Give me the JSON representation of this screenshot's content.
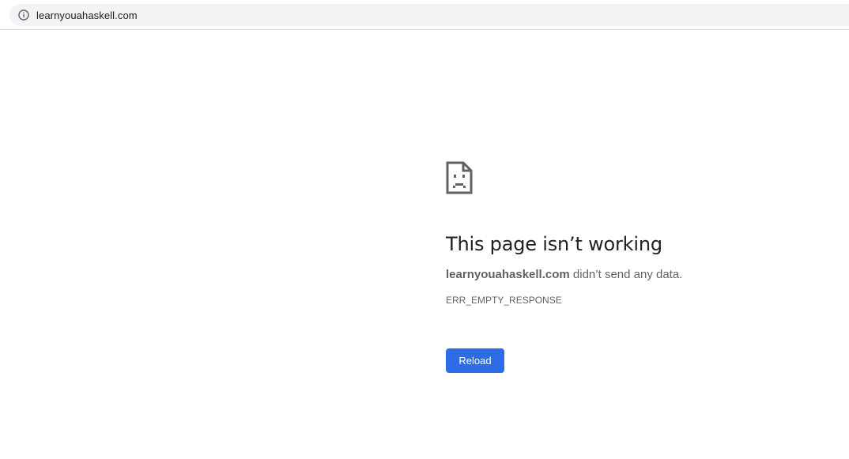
{
  "browser": {
    "url": "learnyouahaskell.com",
    "site_info_icon": "info-circle-icon"
  },
  "error_page": {
    "icon": "sad-document-icon",
    "title": "This page isn’t working",
    "host": "learnyouahaskell.com",
    "message_suffix": " didn’t send any data.",
    "error_code": "ERR_EMPTY_RESPONSE",
    "reload_label": "Reload"
  },
  "colors": {
    "accent": "#2e6be6",
    "omnibox_bg": "#f1f3f4",
    "text_primary": "#202124",
    "text_secondary": "#5f6368"
  }
}
